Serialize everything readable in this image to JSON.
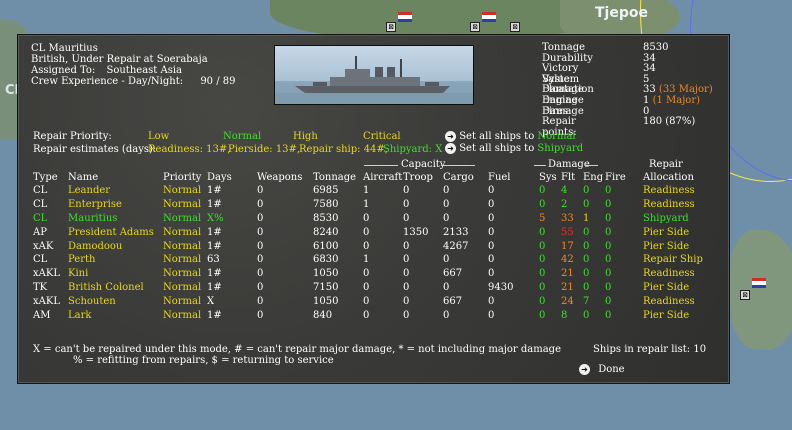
{
  "map": {
    "place_label": "Tjepoe",
    "edge_label": "Cl"
  },
  "ship": {
    "name_line": "CL Mauritius",
    "status_line": "British, Under Repair at Soerabaja",
    "assigned_label": "Assigned To:",
    "assigned_value": "Southeast Asia",
    "crew_label": "Crew Experience - Day/Night:",
    "crew_value": "90 / 89"
  },
  "stats": [
    {
      "label": "Tonnage",
      "value": "8530",
      "extra": ""
    },
    {
      "label": "Durability",
      "value": "34",
      "extra": ""
    },
    {
      "label": "Victory Value:",
      "value": "34",
      "extra": ""
    },
    {
      "label": "System Damage",
      "value": "5",
      "extra": ""
    },
    {
      "label": "Floatation Damage",
      "value": "33",
      "extra": "(33 Major)"
    },
    {
      "label": "Engine Damage",
      "value": "1",
      "extra": "(1 Major)"
    },
    {
      "label": "Fires:",
      "value": "0",
      "extra": ""
    },
    {
      "label": "Repair points:",
      "value": "180 (87%)",
      "extra": ""
    }
  ],
  "repair_priority": {
    "label": "Repair Priority:",
    "options": [
      "Low",
      "Normal",
      "High",
      "Critical"
    ]
  },
  "repair_estimates": {
    "label": "Repair estimates (days):",
    "readiness": "Readiness: 13#,",
    "pierside": "Pierside: 13#,",
    "repair_ship": "Repair ship: 44#,",
    "shipyard": "Shipyard: X"
  },
  "set_all": {
    "normal_prefix": "Set all ships to",
    "normal_value": "Normal",
    "shipyard_prefix": "Set all ships to",
    "shipyard_value": "Shipyard"
  },
  "group_headers": {
    "capacity": "Capacity",
    "damage": "Damage",
    "repair": "Repair"
  },
  "columns": [
    "Type",
    "Name",
    "Priority",
    "Days",
    "Weapons",
    "Tonnage",
    "Aircraft",
    "Troop",
    "Cargo",
    "Fuel",
    "Sys",
    "Flt",
    "Eng",
    "Fire",
    "Allocation"
  ],
  "rows": [
    {
      "type": "CL",
      "name": "Leander",
      "priority": "Normal",
      "days": "1#",
      "weapons": "0",
      "tonnage": "6985",
      "aircraft": "1",
      "troop": "0",
      "cargo": "0",
      "fuel": "0",
      "sys": "0",
      "flt": "4",
      "eng": "0",
      "fire": "0",
      "allocation": "Readiness",
      "highlight": false,
      "flt_red": false
    },
    {
      "type": "CL",
      "name": "Enterprise",
      "priority": "Normal",
      "days": "1#",
      "weapons": "0",
      "tonnage": "7580",
      "aircraft": "1",
      "troop": "0",
      "cargo": "0",
      "fuel": "0",
      "sys": "0",
      "flt": "2",
      "eng": "0",
      "fire": "0",
      "allocation": "Readiness",
      "highlight": false,
      "flt_red": false
    },
    {
      "type": "CL",
      "name": "Mauritius",
      "priority": "Normal",
      "days": "X%",
      "weapons": "0",
      "tonnage": "8530",
      "aircraft": "0",
      "troop": "0",
      "cargo": "0",
      "fuel": "0",
      "sys": "5",
      "flt": "33",
      "eng": "1",
      "fire": "0",
      "allocation": "Shipyard",
      "highlight": true,
      "flt_red": true
    },
    {
      "type": "AP",
      "name": "President Adams",
      "priority": "Normal",
      "days": "1#",
      "weapons": "0",
      "tonnage": "8240",
      "aircraft": "0",
      "troop": "1350",
      "cargo": "2133",
      "fuel": "0",
      "sys": "0",
      "flt": "55",
      "eng": "0",
      "fire": "0",
      "allocation": "Pier Side",
      "highlight": false,
      "flt_red": true
    },
    {
      "type": "xAK",
      "name": "Damodoou",
      "priority": "Normal",
      "days": "1#",
      "weapons": "0",
      "tonnage": "6100",
      "aircraft": "0",
      "troop": "0",
      "cargo": "4267",
      "fuel": "0",
      "sys": "0",
      "flt": "17",
      "eng": "0",
      "fire": "0",
      "allocation": "Pier Side",
      "highlight": false,
      "flt_red": true
    },
    {
      "type": "CL",
      "name": "Perth",
      "priority": "Normal",
      "days": "63",
      "weapons": "0",
      "tonnage": "6830",
      "aircraft": "1",
      "troop": "0",
      "cargo": "0",
      "fuel": "0",
      "sys": "0",
      "flt": "42",
      "eng": "0",
      "fire": "0",
      "allocation": "Repair Ship",
      "highlight": false,
      "flt_red": true
    },
    {
      "type": "xAKL",
      "name": "Kini",
      "priority": "Normal",
      "days": "1#",
      "weapons": "0",
      "tonnage": "1050",
      "aircraft": "0",
      "troop": "0",
      "cargo": "667",
      "fuel": "0",
      "sys": "0",
      "flt": "21",
      "eng": "0",
      "fire": "0",
      "allocation": "Readiness",
      "highlight": false,
      "flt_red": true
    },
    {
      "type": "TK",
      "name": "British Colonel",
      "priority": "Normal",
      "days": "1#",
      "weapons": "0",
      "tonnage": "7150",
      "aircraft": "0",
      "troop": "0",
      "cargo": "0",
      "fuel": "9430",
      "sys": "0",
      "flt": "21",
      "eng": "0",
      "fire": "0",
      "allocation": "Pier Side",
      "highlight": false,
      "flt_red": true
    },
    {
      "type": "xAKL",
      "name": "Schouten",
      "priority": "Normal",
      "days": "X",
      "weapons": "0",
      "tonnage": "1050",
      "aircraft": "0",
      "troop": "0",
      "cargo": "667",
      "fuel": "0",
      "sys": "0",
      "flt": "24",
      "eng": "7",
      "fire": "0",
      "allocation": "Readiness",
      "highlight": false,
      "flt_red": true
    },
    {
      "type": "AM",
      "name": "Lark",
      "priority": "Normal",
      "days": "1#",
      "weapons": "0",
      "tonnage": "840",
      "aircraft": "0",
      "troop": "0",
      "cargo": "0",
      "fuel": "0",
      "sys": "0",
      "flt": "8",
      "eng": "0",
      "fire": "0",
      "allocation": "Pier Side",
      "highlight": false,
      "flt_red": false
    }
  ],
  "legend": {
    "line1": "X = can't be repaired under this mode, # = can't repair major damage, * = not including major damage",
    "line2": "% = refitting from repairs, $ = returning to service"
  },
  "ships_in_list_label": "Ships in repair list: 10",
  "done_label": "Done",
  "colors": {
    "green": "#3ee02c",
    "yellow": "#e6d81c",
    "orange": "#ee8a22",
    "red": "#e8302a",
    "dialog_bg": "#3a3a38"
  }
}
